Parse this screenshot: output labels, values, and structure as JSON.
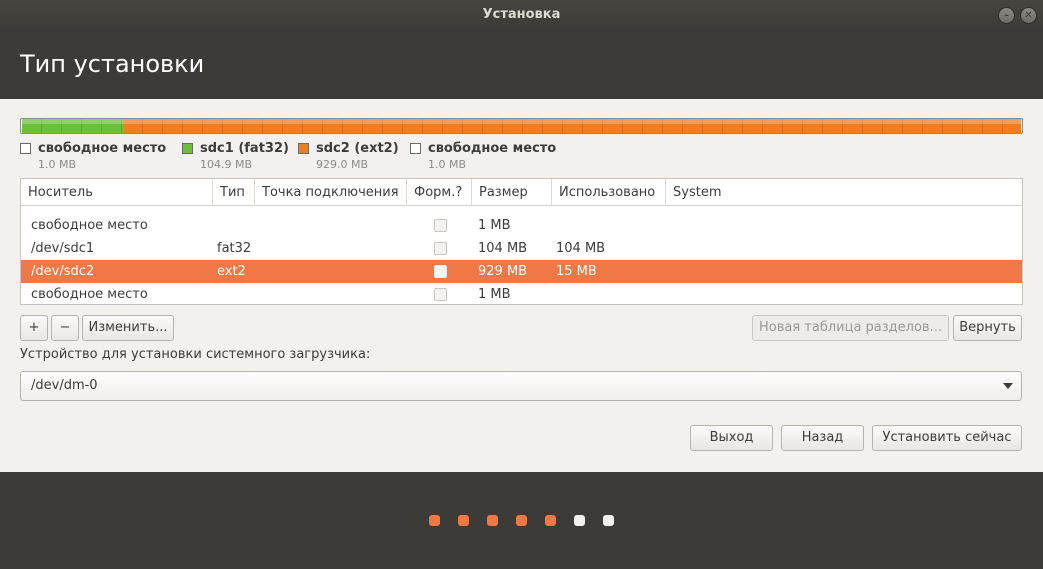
{
  "window": {
    "title": "Установка"
  },
  "header": {
    "title": "Тип установки"
  },
  "legend": [
    {
      "name": "свободное место",
      "size": "1.0 MB",
      "color": "#ffffff"
    },
    {
      "name": "sdc1 (fat32)",
      "size": "104.9 MB",
      "color": "#6cbf3a"
    },
    {
      "name": "sdc2 (ext2)",
      "size": "929.0 MB",
      "color": "#ef7d22"
    },
    {
      "name": "свободное место",
      "size": "1.0 MB",
      "color": "#ffffff"
    }
  ],
  "table": {
    "columns": [
      "Носитель",
      "Тип",
      "Точка подключения",
      "Форм.?",
      "Размер",
      "Использовано",
      "System"
    ],
    "rows": [
      {
        "device": "свободное место",
        "type": "",
        "mount": "",
        "size": "1 MB",
        "used": "",
        "system": ""
      },
      {
        "device": "/dev/sdc1",
        "type": "fat32",
        "mount": "",
        "size": "104 MB",
        "used": "104 MB",
        "system": ""
      },
      {
        "device": "/dev/sdc2",
        "type": "ext2",
        "mount": "",
        "size": "929 MB",
        "used": "15 MB",
        "system": ""
      },
      {
        "device": "свободное место",
        "type": "",
        "mount": "",
        "size": "1 MB",
        "used": "",
        "system": ""
      }
    ],
    "selected_row": 2
  },
  "toolbar": {
    "add_label": "+",
    "remove_label": "−",
    "change_label": "Изменить...",
    "new_table_label": "Новая таблица разделов...",
    "revert_label": "Вернуть"
  },
  "bootloader": {
    "label": "Устройство для установки системного загрузчика:",
    "value": "/dev/dm-0"
  },
  "actions": {
    "quit_label": "Выход",
    "back_label": "Назад",
    "install_label": "Установить сейчас"
  },
  "progress": {
    "total_steps": 7,
    "completed_steps": 5,
    "active_color": "#f07746",
    "inactive_color": "#f2f1f0"
  },
  "colors": {
    "accent": "#f07746",
    "fat32": "#6cbf3a",
    "ext2": "#ef7d22"
  }
}
